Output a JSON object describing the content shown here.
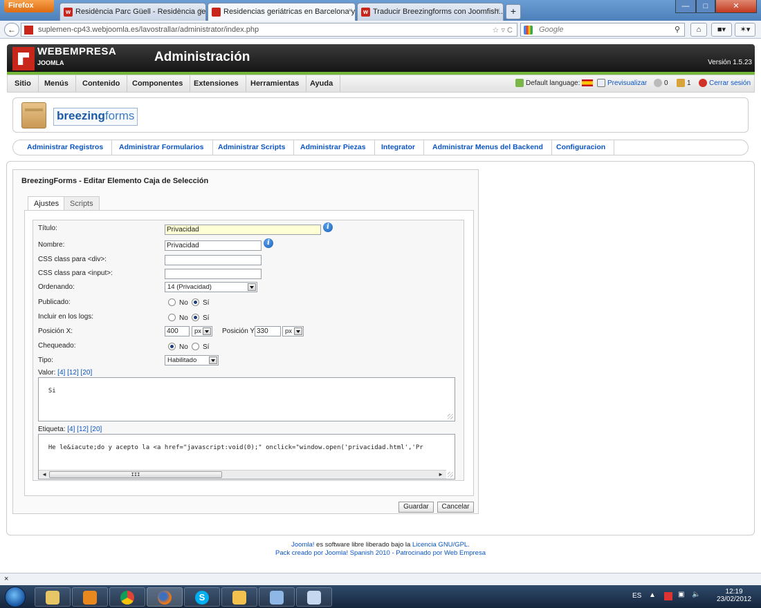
{
  "browser": {
    "app_button": "Firefox",
    "tabs": [
      {
        "label": "Residència Parc Güell - Residència ge...",
        "close": "×"
      },
      {
        "label": "Residencias geriátricas en Barcelona y...",
        "close": "×"
      },
      {
        "label": "Traducir Breezingforms con Joomfish...",
        "close": "×"
      }
    ],
    "new_tab": "+",
    "url": "suplemen-cp43.webjoomla.es/lavostrallar/administrator/index.php",
    "search_placeholder": "Google",
    "status_close": "×"
  },
  "joomla": {
    "brand": "WEBEMPRESA",
    "brand_sub": "JOOMLA",
    "title": "Administración",
    "version": "Versión 1.5.23",
    "menu": [
      "Sitio",
      "Menús",
      "Contenido",
      "Componentes",
      "Extensiones",
      "Herramientas",
      "Ayuda"
    ],
    "status": {
      "default_language": "Default language:",
      "preview": "Previsualizar",
      "messages_count": "0",
      "users_count": "1",
      "logout": "Cerrar sesión"
    }
  },
  "breezing": {
    "logo_bold": "breezing",
    "logo_thin": "forms",
    "nav": [
      "Administrar Registros",
      "Administrar Formularios",
      "Administrar Scripts",
      "Administrar Piezas",
      "Integrator",
      "Administrar Menus del Backend",
      "Configuracion"
    ]
  },
  "editor": {
    "title": "BreezingForms - Editar Elemento Caja de Selección",
    "tabs": [
      "Ajustes",
      "Scripts"
    ],
    "fields": {
      "titulo_label": "Título:",
      "titulo_value": "Privacidad",
      "nombre_label": "Nombre:",
      "nombre_value": "Privacidad",
      "css_div_label": "CSS class para <div>:",
      "css_div_value": "",
      "css_input_label": "CSS class para <input>:",
      "css_input_value": "",
      "ordenando_label": "Ordenando:",
      "ordenando_value": "14 (Privacidad)",
      "publicado_label": "Publicado:",
      "logs_label": "Incluir en los logs:",
      "posx_label": "Posición X:",
      "posx_value": "400",
      "posx_unit": "px",
      "posy_label": "Posición Y:",
      "posy_value": "330",
      "posy_unit": "px",
      "chequeado_label": "Chequeado:",
      "tipo_label": "Tipo:",
      "tipo_value": "Habilitado",
      "valor_label": "Valor:",
      "valor_links": [
        "[4]",
        "[12]",
        "[20]"
      ],
      "valor_value": "Si",
      "etiqueta_label": "Etiqueta:",
      "etiqueta_links": [
        "[4]",
        "[12]",
        "[20]"
      ],
      "etiqueta_value": "He le&iacute;do y acepto la <a href=\"javascript:void(0);\" onclick=\"window.open('privacidad.html','Pr",
      "radio_no": "No",
      "radio_si": "Sí",
      "scroll_thumb": "III"
    },
    "radios": {
      "publicado": "si",
      "logs": "si",
      "chequeado": "no"
    },
    "buttons": {
      "save": "Guardar",
      "cancel": "Cancelar"
    }
  },
  "footer": {
    "line1_prefix": "Joomla!",
    "line1_text": " es software libre liberado bajo la ",
    "line1_link": "Licencia GNU/GPL.",
    "line2": "Pack creado por Joomla! Spanish 2010 - Patrocinado por Web Empresa"
  },
  "taskbar": {
    "lang": "ES",
    "time": "12:19",
    "date": "23/02/2012"
  }
}
